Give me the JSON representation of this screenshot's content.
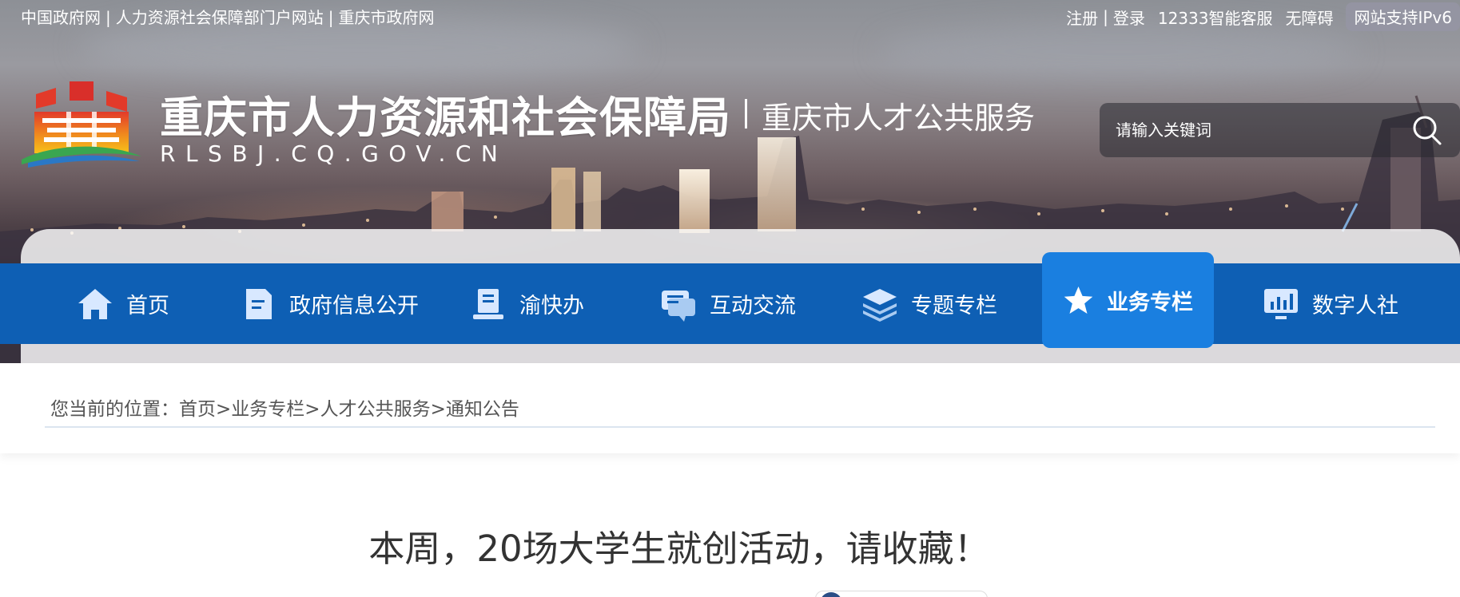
{
  "top_links": {
    "gov": "中国政府网",
    "mohrss": "人力资源社会保障部门户网站",
    "cq_gov": "重庆市政府网",
    "separator": "|"
  },
  "top_right": {
    "register": "注册",
    "login": "登录",
    "separator": "|",
    "service": "12333智能客服",
    "accessibility": "无障碍",
    "ipv6": "网站支持IPv6"
  },
  "header": {
    "title": "重庆市人力资源和社会保障局",
    "domain": "RLSBJ.CQ.GOV.CN",
    "subtitle": "重庆市人才公共服务"
  },
  "search": {
    "placeholder": "请输入关键词",
    "icon": "search-icon"
  },
  "nav": {
    "items": [
      {
        "label": "首页",
        "icon": "home-icon"
      },
      {
        "label": "政府信息公开",
        "icon": "document-icon"
      },
      {
        "label": "渝快办",
        "icon": "book-stand-icon"
      },
      {
        "label": "互动交流",
        "icon": "chat-bubbles-icon"
      },
      {
        "label": "专题专栏",
        "icon": "layers-icon"
      },
      {
        "label": "业务专栏",
        "icon": "star-icon",
        "active": true
      },
      {
        "label": "数字人社",
        "icon": "monitor-chart-icon"
      }
    ],
    "colors": {
      "bar": "#0e5fb4",
      "active": "#1a7fe0"
    }
  },
  "breadcrumb": {
    "prefix": "您当前的位置：",
    "items": [
      "首页",
      "业务专栏",
      "人才公共服务",
      "通知公告"
    ],
    "separator": ">"
  },
  "article": {
    "title": "本周，20场大学生就创活动，请收藏！"
  }
}
